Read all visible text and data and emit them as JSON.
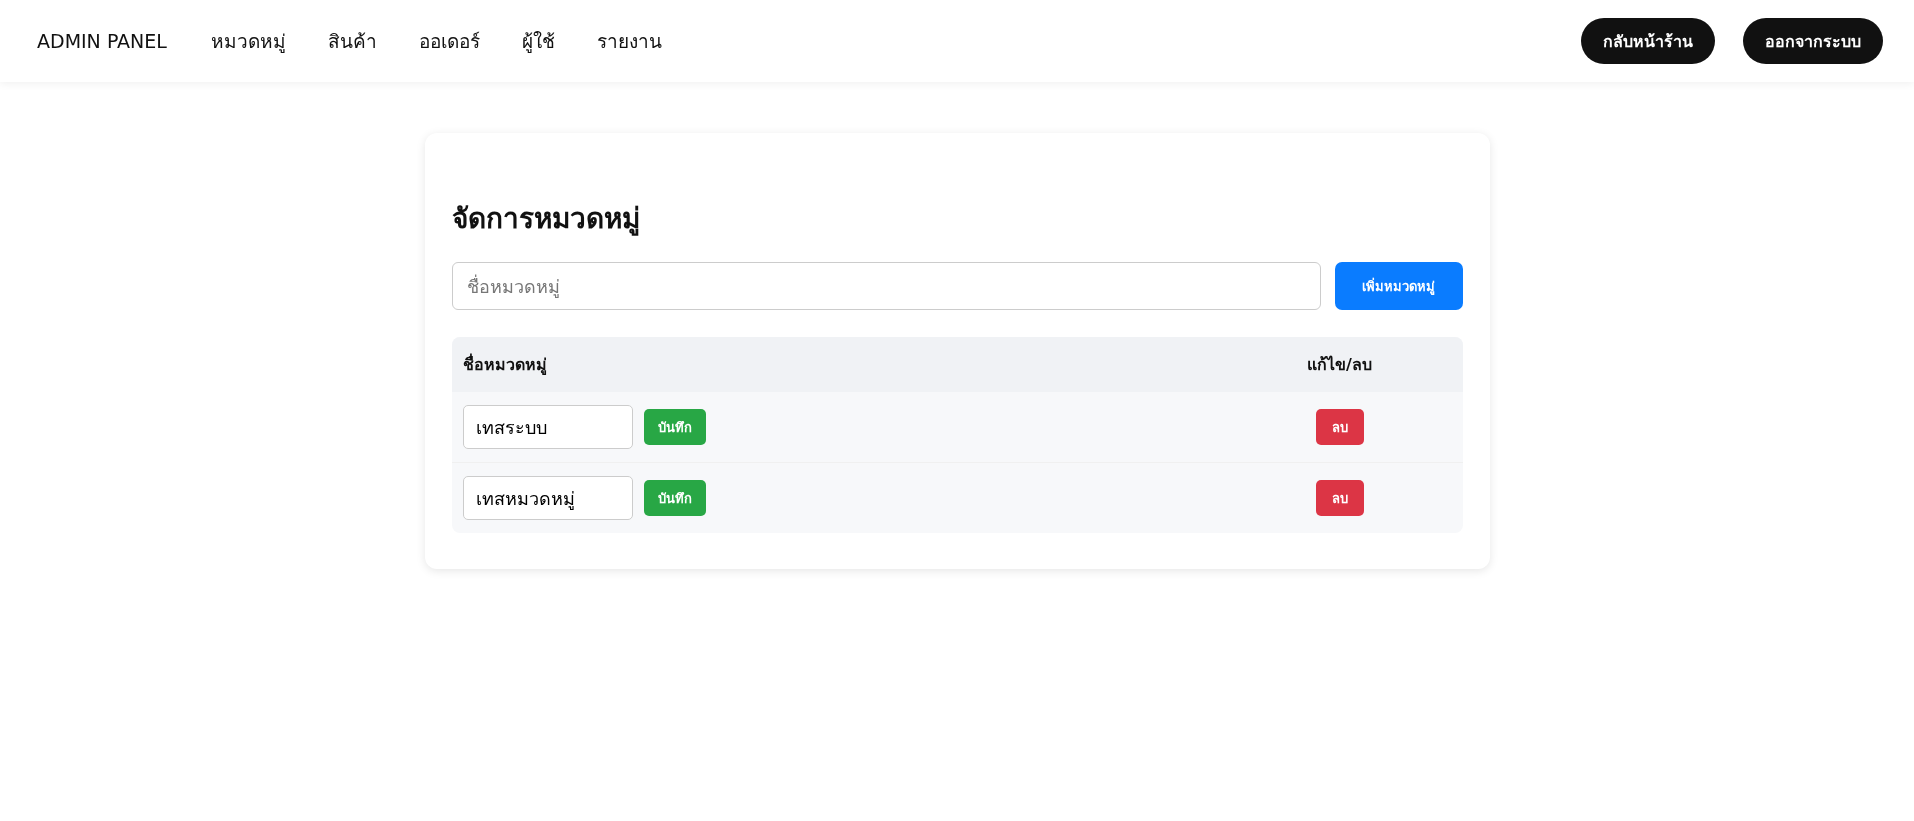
{
  "header": {
    "brand": "ADMIN PANEL",
    "nav": [
      {
        "label": "หมวดหมู่"
      },
      {
        "label": "สินค้า"
      },
      {
        "label": "ออเดอร์"
      },
      {
        "label": "ผู้ใช้"
      },
      {
        "label": "รายงาน"
      }
    ],
    "buttons": [
      "กลับหน้าร้าน",
      "ออกจากระบบ"
    ]
  },
  "card": {
    "title": "จัดการหมวดหมู่",
    "add_form": {
      "placeholder": "ชื่อหมวดหมู่",
      "button": "เพิ่มหมวดหมู่"
    },
    "table": {
      "columns": [
        "ชื่อหมวดหมู่",
        "แก้ไข/ลบ"
      ],
      "rows": [
        {
          "name": "เทสระบบ",
          "save": "บันทึก",
          "delete": "ลบ"
        },
        {
          "name": "เทสหมวดหมู่",
          "save": "บันทึก",
          "delete": "ลบ"
        }
      ]
    }
  }
}
